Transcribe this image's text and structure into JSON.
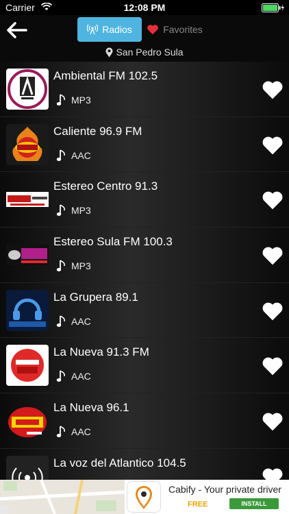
{
  "status": {
    "carrier": "Carrier",
    "time": "12:08 PM"
  },
  "nav": {
    "tabs": [
      {
        "label": "Radios",
        "icon": "antenna-icon",
        "active": true
      },
      {
        "label": "Favorites",
        "icon": "heart-icon",
        "active": false
      }
    ],
    "location": "San Pedro Sula"
  },
  "stations": [
    {
      "name": "Ambiental FM 102.5",
      "format": "MP3"
    },
    {
      "name": "Caliente 96.9 FM",
      "format": "AAC"
    },
    {
      "name": "Estereo Centro 91.3",
      "format": "MP3"
    },
    {
      "name": "Estereo Sula FM 100.3",
      "format": "MP3"
    },
    {
      "name": "La Grupera 89.1",
      "format": "AAC"
    },
    {
      "name": "La Nueva 91.3 FM",
      "format": "AAC"
    },
    {
      "name": "La Nueva 96.1",
      "format": "AAC"
    },
    {
      "name": "La voz del Atlantico 104.5",
      "format": ""
    }
  ],
  "ad": {
    "title": "Cabify - Your private driver",
    "price": "FREE",
    "install": "INSTALL"
  },
  "colors": {
    "accent": "#4fb5e0",
    "heart_tab": "#e0303a"
  }
}
